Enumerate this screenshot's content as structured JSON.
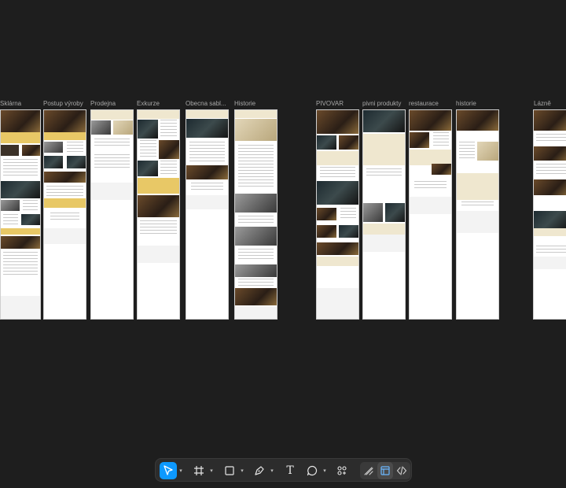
{
  "canvas": {
    "frames": [
      {
        "label": "Sklárna"
      },
      {
        "label": "Postup výroby"
      },
      {
        "label": "Prodejna"
      },
      {
        "label": "Exkurze"
      },
      {
        "label": "Obecna sabl..."
      },
      {
        "label": "Historie"
      },
      {
        "label": "PIVOVAR"
      },
      {
        "label": "pivni produkty"
      },
      {
        "label": "restaurace"
      },
      {
        "label": "historie"
      },
      {
        "label": "Lázně"
      }
    ]
  },
  "toolbar": {
    "tools": [
      {
        "icon": "move-pointer-icon",
        "active": true
      },
      {
        "icon": "frame-hash-icon"
      },
      {
        "icon": "rectangle-icon"
      },
      {
        "icon": "pen-icon"
      },
      {
        "icon": "text-icon",
        "glyph": "T"
      },
      {
        "icon": "comment-bubble-icon"
      },
      {
        "icon": "components-icon"
      }
    ],
    "modes": [
      {
        "icon": "draw-mode-icon"
      },
      {
        "icon": "design-mode-icon",
        "selected": true
      },
      {
        "icon": "dev-mode-icon"
      }
    ],
    "accent": "#0d99ff"
  }
}
